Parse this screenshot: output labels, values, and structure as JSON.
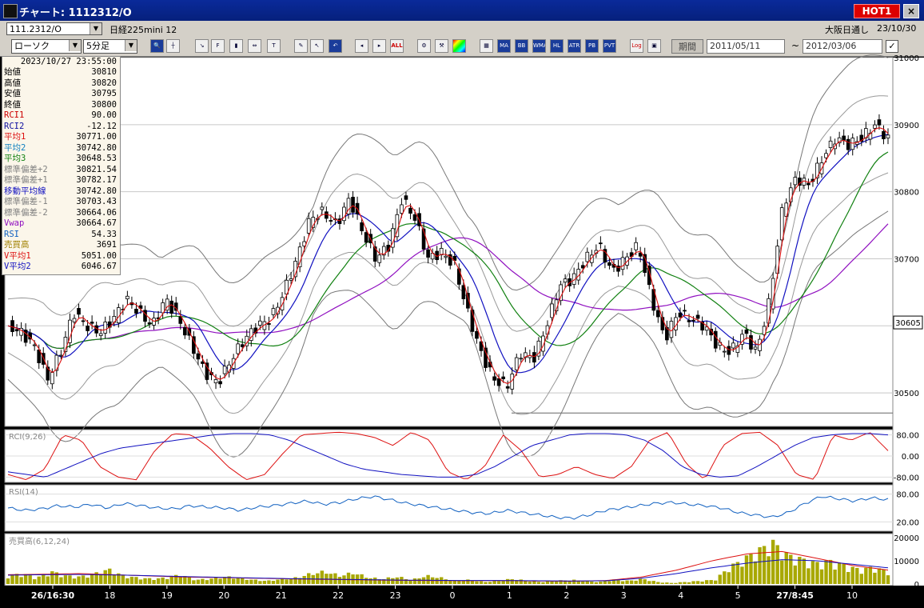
{
  "window": {
    "title": "チャート: 1112312/O",
    "hot_label": "HOT1",
    "close_label": "×"
  },
  "toolbar1": {
    "symbol": "111.2312/O",
    "instrument": "日経225mini 12",
    "market": "大阪日通し",
    "date": "23/10/30"
  },
  "toolbar2": {
    "chart_type": "ローソク",
    "interval": "5分足",
    "period_label": "期間",
    "start_date": "2011/05/11",
    "tilde": "~",
    "end_date": "2012/03/06",
    "buttons": [
      "MA",
      "BB",
      "WMA",
      "HL",
      "ATR",
      "PB",
      "PVT",
      "Log"
    ],
    "all_label": "ALL"
  },
  "info": {
    "datetime": "2023/10/27  23:55:00",
    "rows": [
      {
        "label": "始値",
        "value": "30810",
        "color": "#000000"
      },
      {
        "label": "高値",
        "value": "30820",
        "color": "#000000"
      },
      {
        "label": "安値",
        "value": "30795",
        "color": "#000000"
      },
      {
        "label": "終値",
        "value": "30800",
        "color": "#000000"
      },
      {
        "label": "RCI1",
        "value": "90.00",
        "color": "#cc0000"
      },
      {
        "label": "RCI2",
        "value": "-12.12",
        "color": "#1010a0"
      },
      {
        "label": "平均1",
        "value": "30771.00",
        "color": "#dd1010"
      },
      {
        "label": "平均2",
        "value": "30742.80",
        "color": "#1080c0"
      },
      {
        "label": "平均3",
        "value": "30648.53",
        "color": "#108010"
      },
      {
        "label": "標準偏差+2",
        "value": "30821.54",
        "color": "#808080"
      },
      {
        "label": "標準偏差+1",
        "value": "30782.17",
        "color": "#808080"
      },
      {
        "label": "移動平均線",
        "value": "30742.80",
        "color": "#1010c0"
      },
      {
        "label": "標準偏差-1",
        "value": "30703.43",
        "color": "#808080"
      },
      {
        "label": "標準偏差-2",
        "value": "30664.06",
        "color": "#808080"
      },
      {
        "label": "Vwap",
        "value": "30664.67",
        "color": "#9010c0"
      },
      {
        "label": "RSI",
        "value": "54.33",
        "color": "#1060c0"
      },
      {
        "label": "売買高",
        "value": "3691",
        "color": "#a08000"
      },
      {
        "label": "V平均1",
        "value": "5051.00",
        "color": "#dd1010"
      },
      {
        "label": "V平均2",
        "value": "6046.67",
        "color": "#1010c0"
      }
    ]
  },
  "chart_data": [
    {
      "type": "candlestick",
      "ylim": [
        30450,
        31000
      ],
      "y_ticks": [
        30500,
        30600,
        30700,
        30800,
        30900,
        31000
      ],
      "y_tick_labels": [
        "30500",
        "30700",
        "30800",
        "30900",
        "31000"
      ],
      "current_price": 30605,
      "current_price_label": "30605",
      "x_tick_labels": [
        "26/16:30",
        "18",
        "19",
        "20",
        "21",
        "22",
        "23",
        "0",
        "1",
        "2",
        "3",
        "4",
        "5",
        "27/8:45",
        "10"
      ],
      "close_path": [
        30600,
        30590,
        30570,
        30520,
        30560,
        30620,
        30600,
        30590,
        30610,
        30640,
        30620,
        30600,
        30640,
        30610,
        30570,
        30530,
        30515,
        30550,
        30580,
        30600,
        30610,
        30650,
        30700,
        30760,
        30770,
        30750,
        30790,
        30740,
        30700,
        30720,
        30790,
        30760,
        30700,
        30710,
        30690,
        30620,
        30560,
        30520,
        30510,
        30560,
        30550,
        30600,
        30660,
        30670,
        30700,
        30720,
        30680,
        30700,
        30720,
        30640,
        30580,
        30620,
        30610,
        30600,
        30570,
        30560,
        30590,
        30560,
        30640,
        30780,
        30820,
        30810,
        30850,
        30880,
        30870,
        30880,
        30900,
        30880
      ],
      "indicators": [
        "平均1",
        "平均2",
        "平均3",
        "標準偏差+2",
        "標準偏差+1",
        "標準偏差-1",
        "標準偏差-2",
        "Vwap"
      ]
    },
    {
      "type": "line",
      "title": "RCI(9,26)",
      "ylim": [
        -100,
        100
      ],
      "y_tick_labels": [
        "80.00",
        "0.00",
        "-80.00"
      ],
      "series": [
        {
          "name": "RCI1",
          "color": "#dd1010",
          "values": [
            -70,
            -90,
            -50,
            80,
            60,
            -40,
            -80,
            -90,
            20,
            85,
            80,
            30,
            -40,
            -90,
            -70,
            10,
            80,
            85,
            90,
            85,
            70,
            40,
            90,
            60,
            -60,
            -90,
            -40,
            80,
            20,
            -80,
            -70,
            -40,
            -70,
            -85,
            -40,
            60,
            90,
            -30,
            -90,
            40,
            85,
            90,
            40,
            -70,
            -90,
            80,
            60,
            90,
            20
          ]
        },
        {
          "name": "RCI2",
          "color": "#1010c0",
          "values": [
            -60,
            -70,
            -80,
            -50,
            -20,
            10,
            30,
            40,
            50,
            60,
            70,
            80,
            85,
            85,
            80,
            60,
            30,
            0,
            -30,
            -50,
            -60,
            -70,
            -75,
            -80,
            -80,
            -70,
            -40,
            0,
            40,
            60,
            80,
            85,
            85,
            80,
            60,
            20,
            -40,
            -70,
            -80,
            -75,
            -40,
            0,
            40,
            70,
            80,
            85,
            85,
            80
          ]
        }
      ]
    },
    {
      "type": "line",
      "title": "RSI(14)",
      "ylim": [
        0,
        100
      ],
      "y_tick_labels": [
        "80.00",
        "20.00"
      ],
      "series": [
        {
          "name": "RSI",
          "color": "#1060c0",
          "values": [
            50,
            45,
            48,
            55,
            52,
            58,
            50,
            60,
            55,
            50,
            48,
            55,
            52,
            50,
            45,
            52,
            55,
            60,
            65,
            58,
            62,
            70,
            75,
            68,
            60,
            55,
            50,
            45,
            40,
            38,
            45,
            40,
            35,
            30,
            28,
            35,
            45,
            50,
            55,
            60,
            62,
            58,
            55,
            50,
            40,
            35,
            30,
            40,
            60,
            75,
            70,
            65,
            72,
            68
          ]
        }
      ]
    },
    {
      "type": "bar",
      "title": "売買高(6,12,24)",
      "ylim": [
        0,
        20000
      ],
      "y_tick_labels": [
        "20000",
        "10000",
        "0"
      ],
      "series": [
        {
          "name": "売買高",
          "color": "#a8a800",
          "values": [
            4000,
            5000,
            3000,
            6000,
            4000,
            3500,
            5000,
            7000,
            4000,
            3000,
            2500,
            3000,
            4500,
            2000,
            2500,
            3500,
            3000,
            2000,
            1500,
            2500,
            3000,
            5000,
            6000,
            4000,
            5500,
            3000,
            2500,
            3500,
            2000,
            4000,
            3000,
            1500,
            2000,
            1000,
            1500,
            2500,
            1500,
            1000,
            1500,
            2000,
            1500,
            1000,
            2000,
            1500,
            2500,
            1000,
            500,
            1000,
            1500,
            2000,
            8000,
            12000,
            16000,
            20000,
            14000,
            12000,
            10000,
            11000,
            9000,
            7000,
            8000,
            6000
          ]
        },
        {
          "name": "V平均1",
          "color": "#dd1010",
          "values": [
            4000,
            4200,
            4500,
            4000,
            3500,
            3000,
            2800,
            2500,
            2200,
            2000,
            1800,
            1600,
            1500,
            1400,
            1500,
            1300,
            1200,
            1500,
            3000,
            6000,
            10000,
            13000,
            14000,
            11000,
            8000,
            6000
          ]
        },
        {
          "name": "V平均2",
          "color": "#1010c0",
          "values": [
            3800,
            4000,
            4100,
            3900,
            3600,
            3200,
            2900,
            2600,
            2300,
            2100,
            1900,
            1700,
            1600,
            1500,
            1500,
            1400,
            1300,
            1400,
            2500,
            4500,
            7000,
            9000,
            10500,
            10000,
            8500,
            7000
          ]
        }
      ]
    }
  ]
}
